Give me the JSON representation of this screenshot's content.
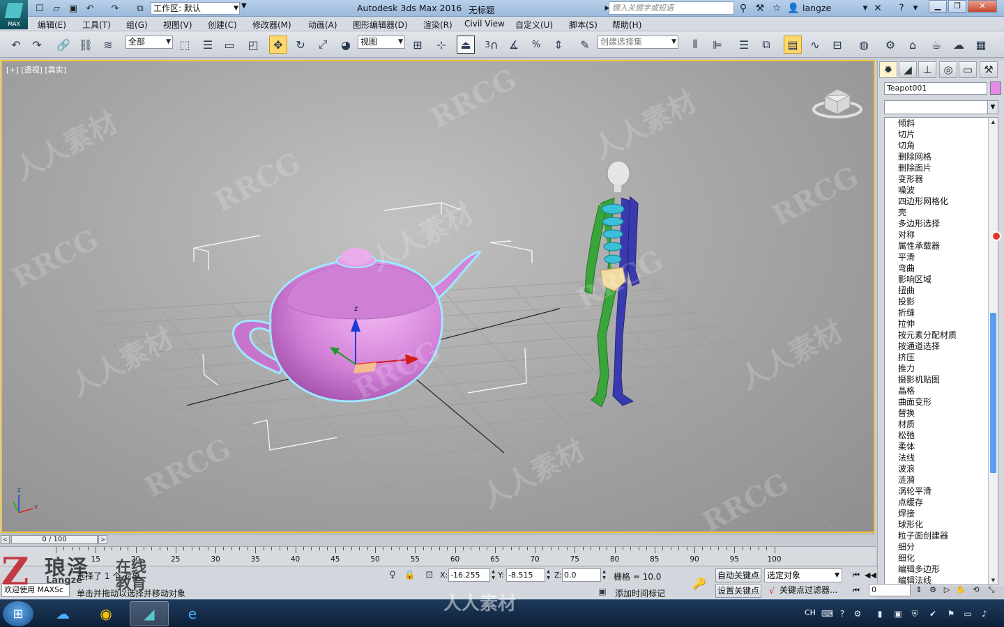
{
  "titlebar": {
    "app_logo": "MAX",
    "workspace_label": "工作区: 默认",
    "title": "Autodesk 3ds Max 2016",
    "document": "无标题",
    "search_placeholder": "键入关键字或短语",
    "user": "langze"
  },
  "menu": [
    "编辑(E)",
    "工具(T)",
    "组(G)",
    "视图(V)",
    "创建(C)",
    "修改器(M)",
    "动画(A)",
    "图形编辑器(D)",
    "渲染(R)",
    "Civil View",
    "自定义(U)",
    "脚本(S)",
    "帮助(H)"
  ],
  "toolbar": {
    "selection_filter": "全部",
    "ref_coord": "视图",
    "named_selection": "创建选择集",
    "snap_labels": [
      "3",
      "%"
    ]
  },
  "viewport": {
    "label": "[+] [透视] [真实]",
    "selected_object": "Teapot001",
    "watermarks": [
      "RRCG",
      "人人素材",
      "RRCG",
      "人人素材",
      "RRCG",
      "人人素材",
      "RRCG",
      "人人素材",
      "RRCG",
      "人人素材"
    ],
    "axis_labels": [
      "z",
      "x"
    ],
    "gizmo_label": "z"
  },
  "command_panel": {
    "object_name": "Teapot001",
    "object_color": "#e78ae6",
    "modifiers": [
      "倾斜",
      "切片",
      "切角",
      "删除网格",
      "删除面片",
      "变形器",
      "噪波",
      "四边形网格化",
      "壳",
      "多边形选择",
      "对称",
      "属性承载器",
      "平滑",
      "弯曲",
      "影响区域",
      "扭曲",
      "投影",
      "折缝",
      "拉伸",
      "按元素分配材质",
      "按通道选择",
      "挤压",
      "推力",
      "摄影机贴图",
      "晶格",
      "曲面变形",
      "替换",
      "材质",
      "松弛",
      "柔体",
      "法线",
      "波浪",
      "涟漪",
      "涡轮平滑",
      "点缓存",
      "焊接",
      "球形化",
      "粒子面创建器",
      "细分",
      "细化",
      "编辑多边形",
      "编辑法线"
    ]
  },
  "timeline": {
    "frame_display": "0 / 100",
    "ticks": [
      "15",
      "20",
      "25",
      "30",
      "35",
      "40",
      "45",
      "50",
      "55",
      "60",
      "65",
      "70",
      "75",
      "80",
      "85",
      "90",
      "95",
      "100"
    ]
  },
  "status": {
    "maxscript": "欢迎使用 MAXSc",
    "selection": "选择了 1 个 对象",
    "prompt": "单击并拖动以选择并移动对象",
    "x_label": "X:",
    "x_value": "-16.255",
    "y_label": "Y:",
    "y_value": "-8.515",
    "z_label": "Z:",
    "z_value": "0.0",
    "grid": "栅格 = 10.0",
    "add_time_tag": "添加时间标记",
    "auto_key": "自动关键点",
    "set_key": "设置关键点",
    "key_mode": "选定对象",
    "key_filters": "关键点过滤器...",
    "frame": "0"
  },
  "brand_overlay": {
    "logo_letter": "Z",
    "name": "琅泽",
    "online": "在线",
    "edu": "教育",
    "sub": "Langze"
  },
  "bottom_watermark": "人人素材",
  "taskbar": {
    "lang": "CH",
    "apps": [
      "windows-start",
      "baidu-netdisk",
      "chrome",
      "3ds-max",
      "internet-explorer"
    ]
  }
}
